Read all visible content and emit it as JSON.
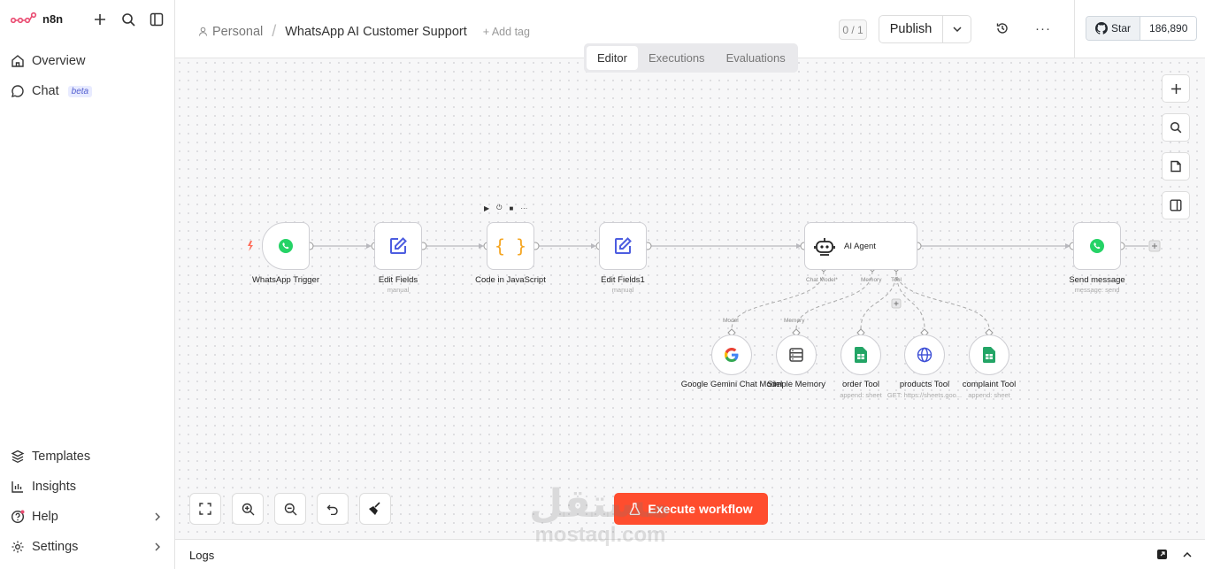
{
  "brand": {
    "name": "n8n",
    "color": "#ea4b71"
  },
  "sidebar": {
    "top_items": [
      {
        "label": "Overview",
        "icon": "home-icon"
      },
      {
        "label": "Chat",
        "icon": "chat-icon",
        "badge": "beta"
      }
    ],
    "bottom_items": [
      {
        "label": "Templates",
        "icon": "templates-icon"
      },
      {
        "label": "Insights",
        "icon": "insights-icon"
      },
      {
        "label": "Help",
        "icon": "help-icon"
      },
      {
        "label": "Settings",
        "icon": "settings-icon"
      }
    ]
  },
  "header": {
    "project": "Personal",
    "separator": "/",
    "workflow_name": "WhatsApp AI Customer Support",
    "add_tag": "+ Add tag",
    "version_counter": "0 / 1",
    "publish_label": "Publish",
    "github": {
      "star_label": "Star",
      "count": "186,890"
    }
  },
  "tabs": [
    {
      "label": "Editor",
      "active": true
    },
    {
      "label": "Executions",
      "active": false
    },
    {
      "label": "Evaluations",
      "active": false
    }
  ],
  "nodes": [
    {
      "label": "WhatsApp Trigger",
      "sub": ""
    },
    {
      "label": "Edit Fields",
      "sub": "manual"
    },
    {
      "label": "Code in JavaScript",
      "sub": ""
    },
    {
      "label": "Edit Fields1",
      "sub": "manual"
    },
    {
      "label": "AI Agent",
      "sub": ""
    },
    {
      "label": "Send message",
      "sub": "message: send"
    }
  ],
  "agent_ports": {
    "chat_model": "Chat Model*",
    "memory": "Memory",
    "tool": "Tool"
  },
  "sub_nodes": [
    {
      "label": "Google Gemini Chat Model",
      "port": "Model",
      "sub": ""
    },
    {
      "label": "Simple Memory",
      "port": "Memory",
      "sub": ""
    },
    {
      "label": "order Tool",
      "port": "",
      "sub": "append: sheet"
    },
    {
      "label": "products Tool",
      "port": "",
      "sub": "GET: https://sheets.goo..."
    },
    {
      "label": "complaint Tool",
      "port": "",
      "sub": "append: sheet"
    }
  ],
  "execute_button": "Execute workflow",
  "logs_label": "Logs",
  "watermark": {
    "arabic": "مستقل",
    "latin": "mostaql.com"
  },
  "colors": {
    "accent": "#ff4d2e",
    "whatsapp": "#25d366",
    "edit": "#4d5de0",
    "code": "#f5a623",
    "sheets": "#23a566"
  }
}
